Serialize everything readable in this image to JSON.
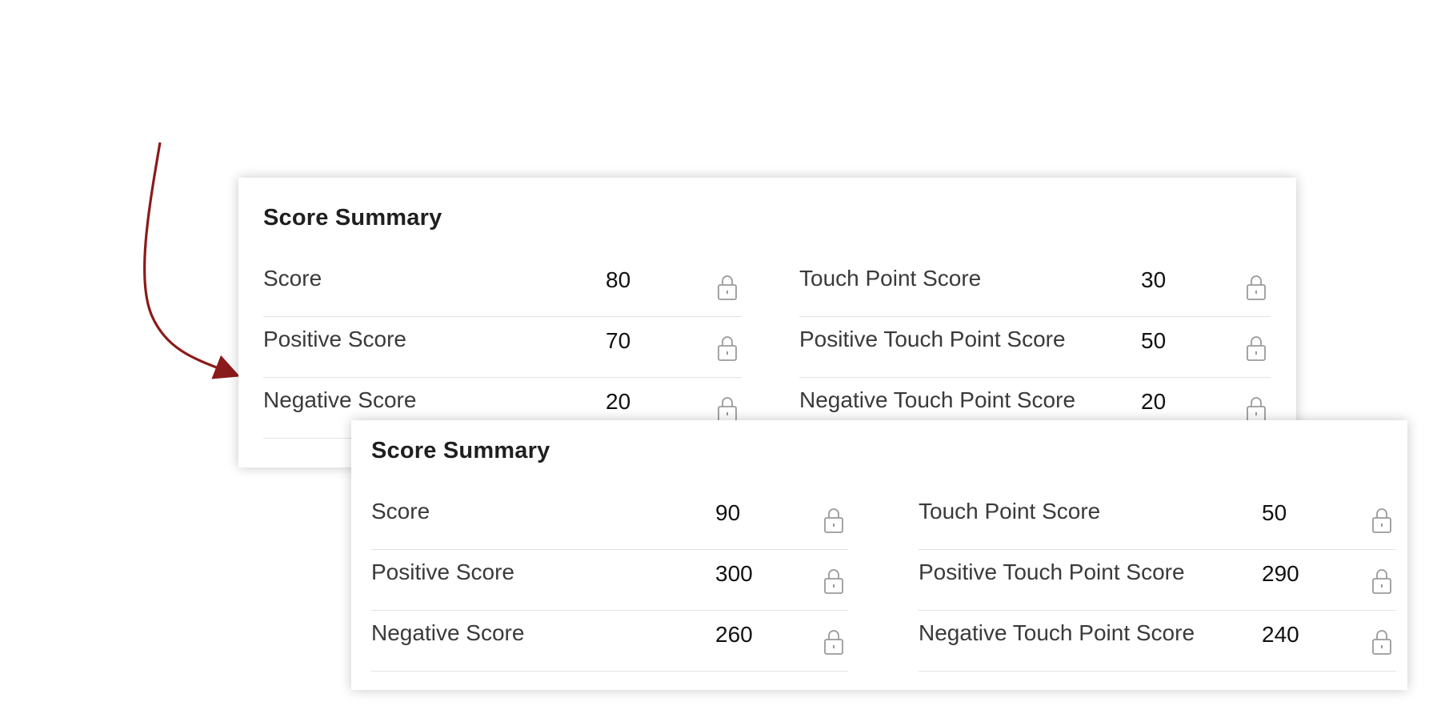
{
  "annotation": {
    "arrow_color": "#8b1a1a"
  },
  "before": {
    "title": "Score Summary",
    "left_fields": [
      {
        "label": "Score",
        "value": "80"
      },
      {
        "label": "Positive Score",
        "value": "70"
      },
      {
        "label": "Negative Score",
        "value": "20"
      }
    ],
    "right_fields": [
      {
        "label": "Touch Point Score",
        "value": "30"
      },
      {
        "label": "Positive Touch Point Score",
        "value": "50"
      },
      {
        "label": "Negative Touch Point Score",
        "value": "20"
      }
    ]
  },
  "after": {
    "title": "Score Summary",
    "left_fields": [
      {
        "label": "Score",
        "value": "90"
      },
      {
        "label": "Positive Score",
        "value": "300"
      },
      {
        "label": "Negative Score",
        "value": "260"
      }
    ],
    "right_fields": [
      {
        "label": "Touch Point Score",
        "value": "50"
      },
      {
        "label": "Positive Touch Point Score",
        "value": "290"
      },
      {
        "label": "Negative Touch Point Score",
        "value": "240"
      }
    ]
  },
  "icons": {
    "lock": "lock-icon"
  }
}
